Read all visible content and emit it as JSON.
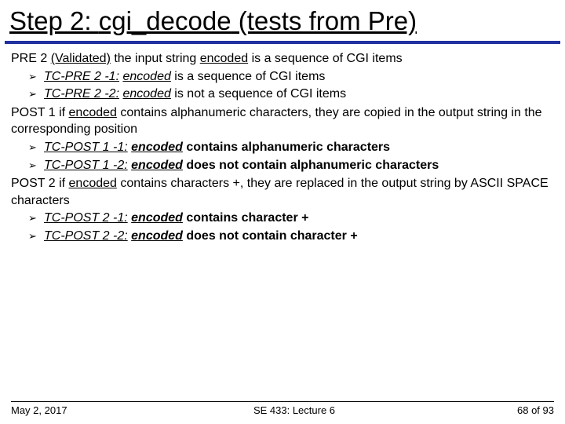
{
  "title": {
    "prefix": "Step 2: ",
    "code": "cgi_decode",
    "suffix": " (tests from Pre)"
  },
  "sections": [
    {
      "head": {
        "label": "PRE 2",
        "validated": "(Validated)",
        "text_before": " the input string ",
        "enc": "encoded",
        "text_after": " is a sequence of CGI items"
      },
      "bullets": [
        {
          "tc": "TC-PRE 2 -1:",
          "enc": "encoded",
          "rest": " is a sequence of CGI items"
        },
        {
          "tc": "TC-PRE 2 -2:",
          "enc": "encoded",
          "rest": " is not a sequence of CGI items"
        }
      ]
    },
    {
      "head2": {
        "label": "POST 1",
        "pre": " if ",
        "enc": "encoded",
        "mid": " contains alphanumeric characters, they are copied in the output string in the corresponding position"
      },
      "bullets": [
        {
          "tc": "TC-POST 1 -1:",
          "enc": "encoded",
          "rest": " contains alphanumeric characters"
        },
        {
          "tc": "TC-POST 1 -2:",
          "enc": "encoded",
          "rest": " does not contain alphanumeric characters"
        }
      ]
    },
    {
      "head2": {
        "label": "POST 2",
        "pre": " if ",
        "enc": "encoded",
        "mid": " contains characters +, they are replaced in the output string by ASCII SPACE characters"
      },
      "bullets": [
        {
          "tc": "TC-POST 2 -1:",
          "enc": "encoded",
          "rest": " contains character +"
        },
        {
          "tc": "TC-POST 2 -2:",
          "enc": "encoded",
          "rest": " does not contain character +"
        }
      ]
    }
  ],
  "footer": {
    "date": "May 2, 2017",
    "course": "SE 433: Lecture 6",
    "page": "68 of 93"
  }
}
